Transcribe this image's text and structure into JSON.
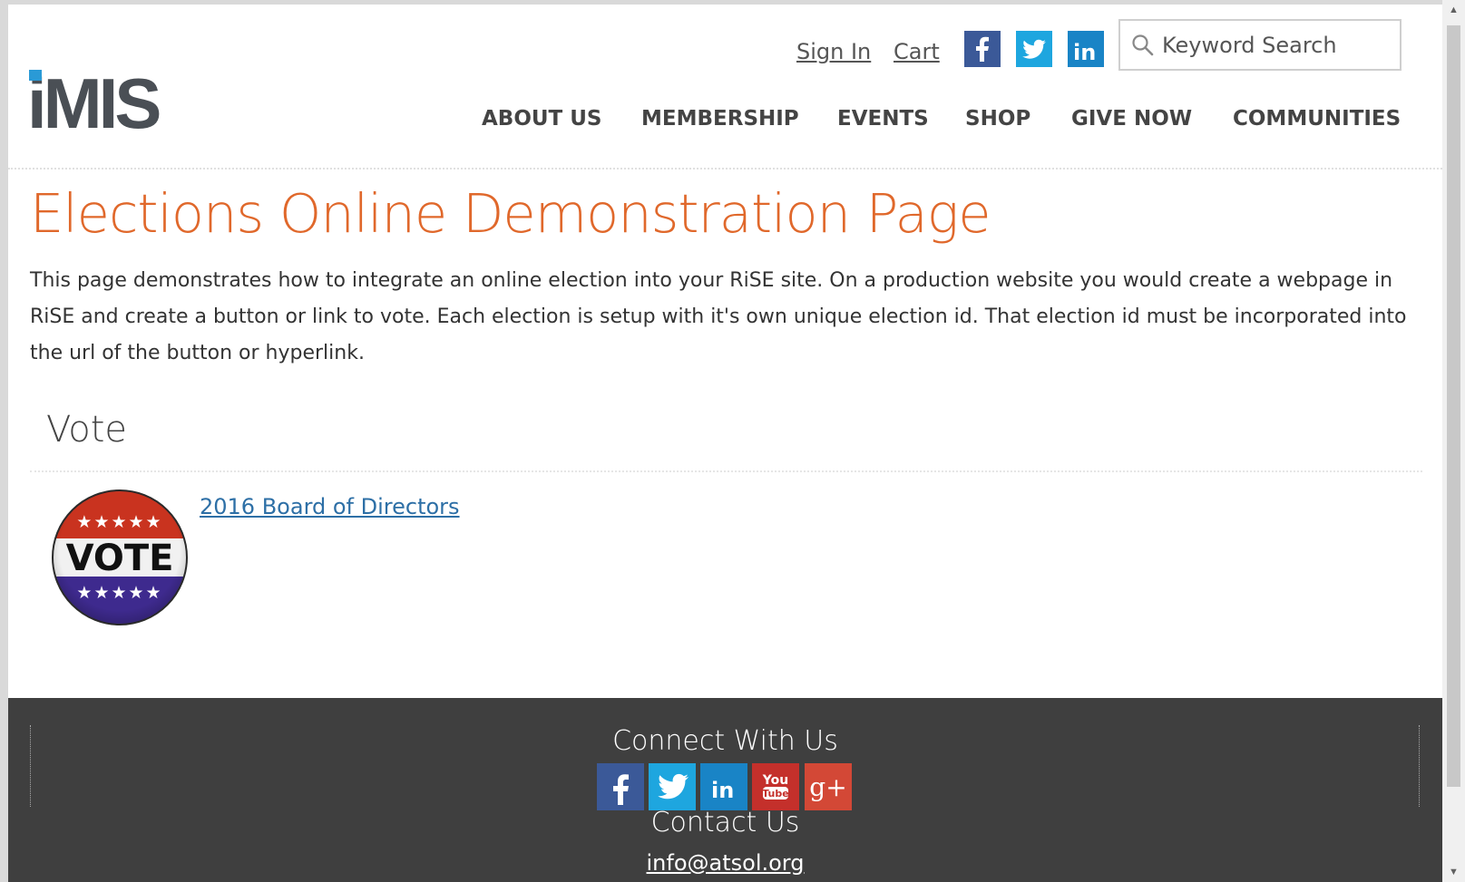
{
  "header": {
    "logo_text": "iMIS",
    "sign_in": "Sign In",
    "cart": "Cart",
    "search": {
      "placeholder": "Keyword Search",
      "icon": "search-icon"
    },
    "social_icons": [
      "facebook-icon",
      "twitter-icon",
      "linkedin-icon"
    ],
    "nav": [
      {
        "label": "ABOUT US"
      },
      {
        "label": "MEMBERSHIP"
      },
      {
        "label": "EVENTS"
      },
      {
        "label": "SHOP"
      },
      {
        "label": "GIVE NOW"
      },
      {
        "label": "COMMUNITIES"
      }
    ]
  },
  "main": {
    "title": "Elections Online Demonstration Page",
    "intro": "This page demonstrates how to integrate an online election into your RiSE site. On a production website you would create a webpage in RiSE and create a button or link to vote. Each election is setup with it's own unique election id. That election id must be incorporated into the url of the button or hyperlink.",
    "vote_section": {
      "title": "Vote",
      "badge_text": "VOTE",
      "badge_stars": "★★★★★",
      "election_link": "2016 Board of Directors"
    }
  },
  "footer": {
    "connect_title": "Connect With Us",
    "social_icons": [
      "facebook-icon",
      "twitter-icon",
      "linkedin-icon",
      "youtube-icon",
      "google-plus-icon"
    ],
    "youtube_text_1": "You",
    "youtube_text_2": "Tube",
    "gplus_text": "g+",
    "contact_title": "Contact Us",
    "email": "info@atsol.org"
  },
  "colors": {
    "title_orange": "#e0682b",
    "nav_text": "#444444",
    "link_blue": "#2d6fa6",
    "footer_bg": "#3f3f3f",
    "facebook": "#3b5998",
    "twitter": "#1da1f2",
    "linkedin": "#0e76a8",
    "youtube": "#c4302b",
    "google_plus": "#d34836"
  }
}
